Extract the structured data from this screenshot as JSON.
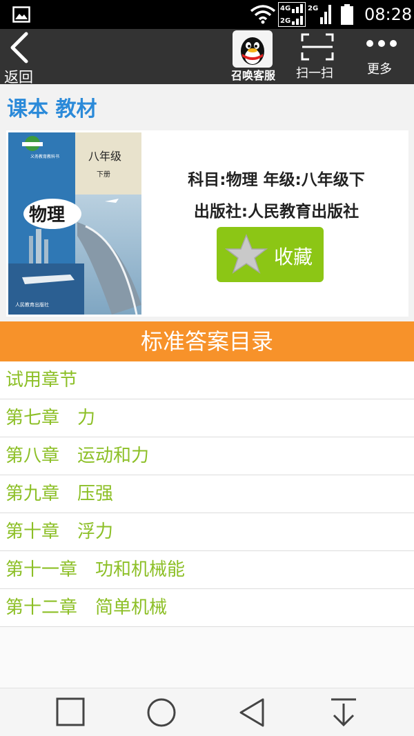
{
  "status_bar": {
    "time": "08:28",
    "net_tag_1": "4G",
    "net_tag_2": "2G",
    "net_tag_3": "2G",
    "icons": [
      "gallery-icon",
      "wifi-icon",
      "signal-4g-2g-icon",
      "signal-2g-icon",
      "battery-icon"
    ]
  },
  "action_bar": {
    "back_label": "返回",
    "qq_label": "召唤客服",
    "scan_label": "扫一扫",
    "more_label": "更多"
  },
  "section_title": "课本 教材",
  "book": {
    "info_line_1": "科目:物理 年级:八年级下",
    "info_line_2": "出版社:人民教育出版社",
    "favorite_label": "收藏",
    "cover": {
      "grade": "八年级",
      "volume": "下册",
      "subject": "物理"
    }
  },
  "answers_header": "标准答案目录",
  "chapters": [
    "试用章节",
    "第七章　力",
    "第八章　运动和力",
    "第九章　压强",
    "第十章　浮力",
    "第十一章　功和机械能",
    "第十二章　简单机械"
  ],
  "colors": {
    "accent_blue": "#2b8ad9",
    "chapter_green": "#8cbf26",
    "favorite_green": "#8cc615",
    "header_orange": "#f7922a",
    "action_bar": "#333333"
  }
}
